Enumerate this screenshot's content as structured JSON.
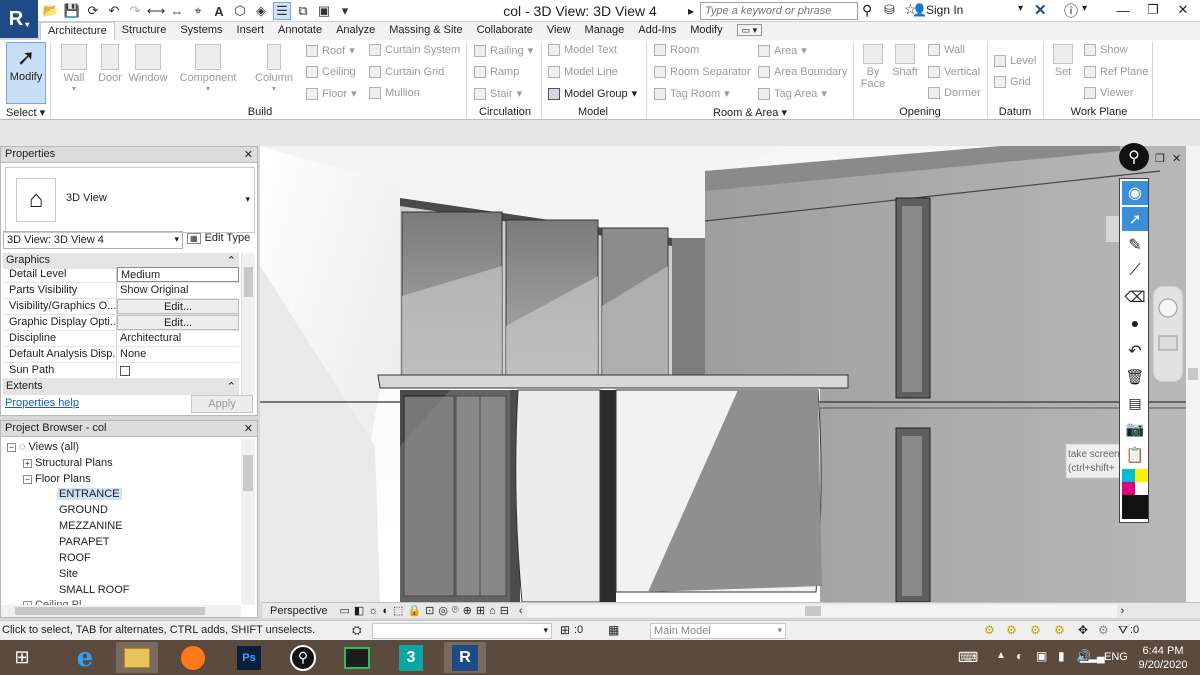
{
  "app": {
    "logo_letter": "R",
    "title": "col - 3D View: 3D View 4",
    "search_placeholder": "Type a keyword or phrase",
    "signin": "Sign In"
  },
  "ribbon": {
    "tabs": [
      "Architecture",
      "Structure",
      "Systems",
      "Insert",
      "Annotate",
      "Analyze",
      "Massing & Site",
      "Collaborate",
      "View",
      "Manage",
      "Add-Ins",
      "Modify"
    ],
    "modify": "Modify",
    "select_label": "Select",
    "build": {
      "wall": "Wall",
      "door": "Door",
      "window": "Window",
      "component": "Component",
      "column": "Column",
      "roof": "Roof",
      "ceiling": "Ceiling",
      "floor": "Floor",
      "curtain_system": "Curtain System",
      "curtain_grid": "Curtain Grid",
      "mullion": "Mullion",
      "label": "Build"
    },
    "circulation": {
      "railing": "Railing",
      "ramp": "Ramp",
      "stair": "Stair",
      "label": "Circulation"
    },
    "model": {
      "model_text": "Model Text",
      "model_line": "Model Line",
      "model_group": "Model Group",
      "label": "Model"
    },
    "room_area": {
      "room": "Room",
      "room_separator": "Room Separator",
      "tag_room": "Tag Room",
      "area": "Area",
      "area_boundary": "Area Boundary",
      "tag_area": "Tag Area",
      "label": "Room & Area"
    },
    "opening": {
      "by_face": "By Face",
      "shaft": "Shaft",
      "wall": "Wall",
      "vertical": "Vertical",
      "dormer": "Dormer",
      "label": "Opening"
    },
    "datum": {
      "level": "Level",
      "grid": "Grid",
      "label": "Datum"
    },
    "work_plane": {
      "set": "Set",
      "show": "Show",
      "ref_plane": "Ref Plane",
      "viewer": "Viewer",
      "label": "Work Plane"
    }
  },
  "properties": {
    "title": "Properties",
    "type_name": "3D View",
    "view_selector": "3D View: 3D View 4",
    "edit_type": "Edit Type",
    "graphics_header": "Graphics",
    "rows": [
      {
        "key": "Detail Level",
        "value": "Medium"
      },
      {
        "key": "Parts Visibility",
        "value": "Show Original"
      },
      {
        "key": "Visibility/Graphics O...",
        "value": "Edit..."
      },
      {
        "key": "Graphic Display Opti...",
        "value": "Edit..."
      },
      {
        "key": "Discipline",
        "value": "Architectural"
      },
      {
        "key": "Default Analysis Disp...",
        "value": "None"
      },
      {
        "key": "Sun Path",
        "value": ""
      }
    ],
    "extents_header": "Extents",
    "help": "Properties help",
    "apply": "Apply"
  },
  "browser": {
    "title": "Project Browser - col",
    "root": "Views (all)",
    "nodes": [
      "Structural Plans",
      "Floor Plans",
      "ENTRANCE",
      "GROUND",
      "MEZZANINE",
      "PARAPET",
      "ROOF",
      "Site",
      "SMALL ROOF",
      "Ceiling Pl..."
    ]
  },
  "viewport": {
    "view_mode": "Perspective",
    "tooltip_line1": "take screen",
    "tooltip_line2": "(ctrl+shift+"
  },
  "statusbar": {
    "message": "Click to select, TAB for alternates, CTRL adds, SHIFT unselects.",
    "zero1": ":0",
    "main_model": "Main Model",
    "filter_zero": ":0"
  },
  "taskbar": {
    "lang": "ENG",
    "time": "6:44 PM",
    "date": "9/20/2020"
  },
  "colors": {
    "ribbon_blue": "#c9dff5",
    "logo_blue": "#1e4a85",
    "taskbar": "#5b4a3e"
  }
}
